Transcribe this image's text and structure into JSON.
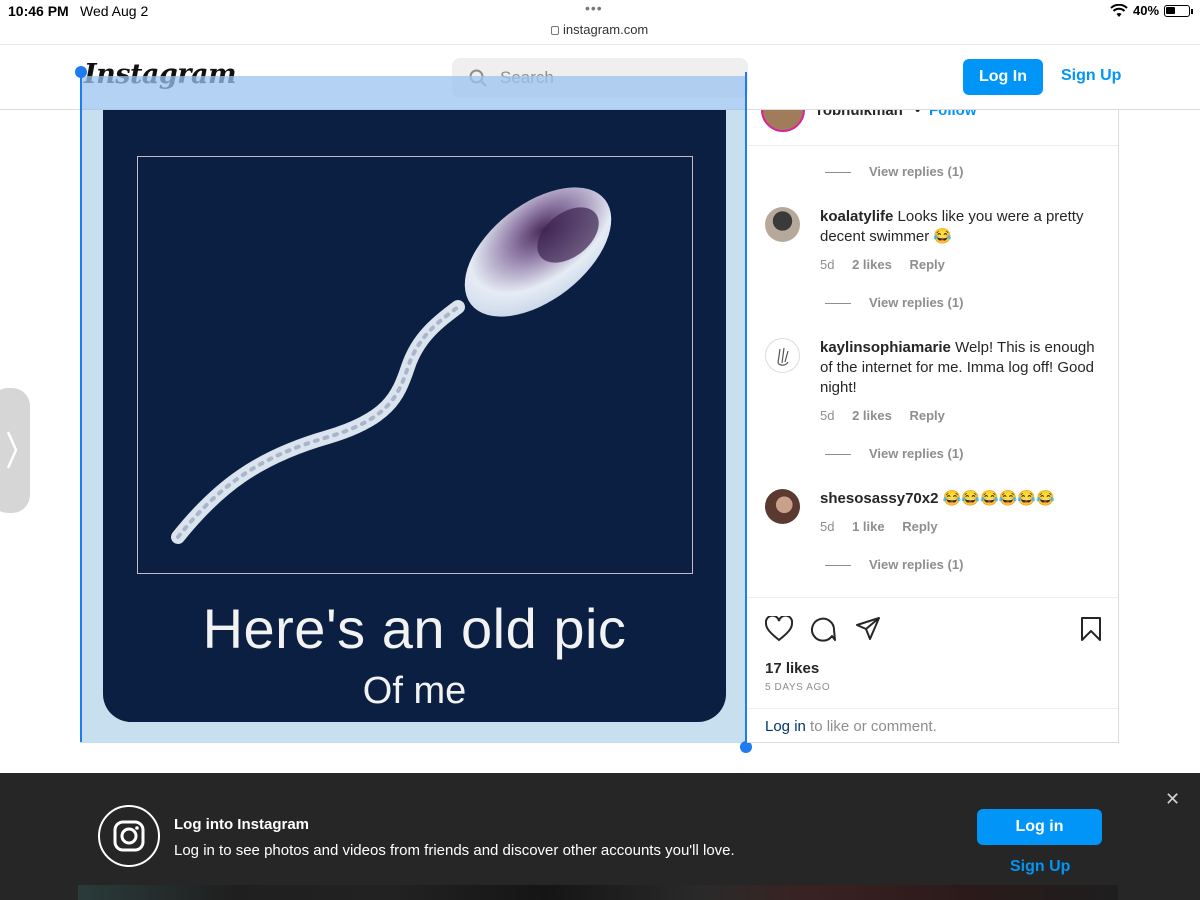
{
  "status_bar": {
    "time": "10:46 PM",
    "date": "Wed Aug 2",
    "dots": "•••",
    "url": "instagram.com",
    "battery": "40%"
  },
  "header": {
    "logo": "Instagram",
    "search_placeholder": "Search",
    "login_label": "Log In",
    "signup_label": "Sign Up"
  },
  "post": {
    "caption_main": "Here's an old pic",
    "caption_sub": "Of me"
  },
  "panel": {
    "username": "robhulkman",
    "separator": "•",
    "follow_label": "Follow",
    "more_label": "•••",
    "view_replies": "View replies (1)",
    "comments": [
      {
        "user": "koalatylife",
        "text": "Looks like you were a pretty decent swimmer 😂",
        "age": "5d",
        "likes": "2 likes",
        "reply": "Reply"
      },
      {
        "user": "kaylinsophiamarie",
        "text": "Welp! This is enough of the internet for me. Imma log off! Good night!",
        "age": "5d",
        "likes": "2 likes",
        "reply": "Reply"
      },
      {
        "user": "shesosassy70x2",
        "text": "😂😂😂😂😂😂",
        "age": "5d",
        "likes": "1 like",
        "reply": "Reply"
      }
    ],
    "likes_count": "17 likes",
    "posted": "5 DAYS AGO",
    "login_link": "Log in",
    "login_rest": " to like or comment."
  },
  "banner": {
    "title": "Log into Instagram",
    "description": "Log in to see photos and videos from friends and discover other accounts you'll love.",
    "login_label": "Log in",
    "signup_label": "Sign Up",
    "close_label": "✕"
  },
  "icons": {
    "heart": "heart-icon",
    "comment": "comment-icon",
    "share": "share-icon",
    "save": "bookmark-icon",
    "search": "search-icon",
    "instagram": "instagram-icon"
  },
  "colors": {
    "accent": "#0095f6",
    "selection": "#1e7cf0",
    "post_bg": "#0b1f42",
    "banner_bg": "#262626"
  }
}
